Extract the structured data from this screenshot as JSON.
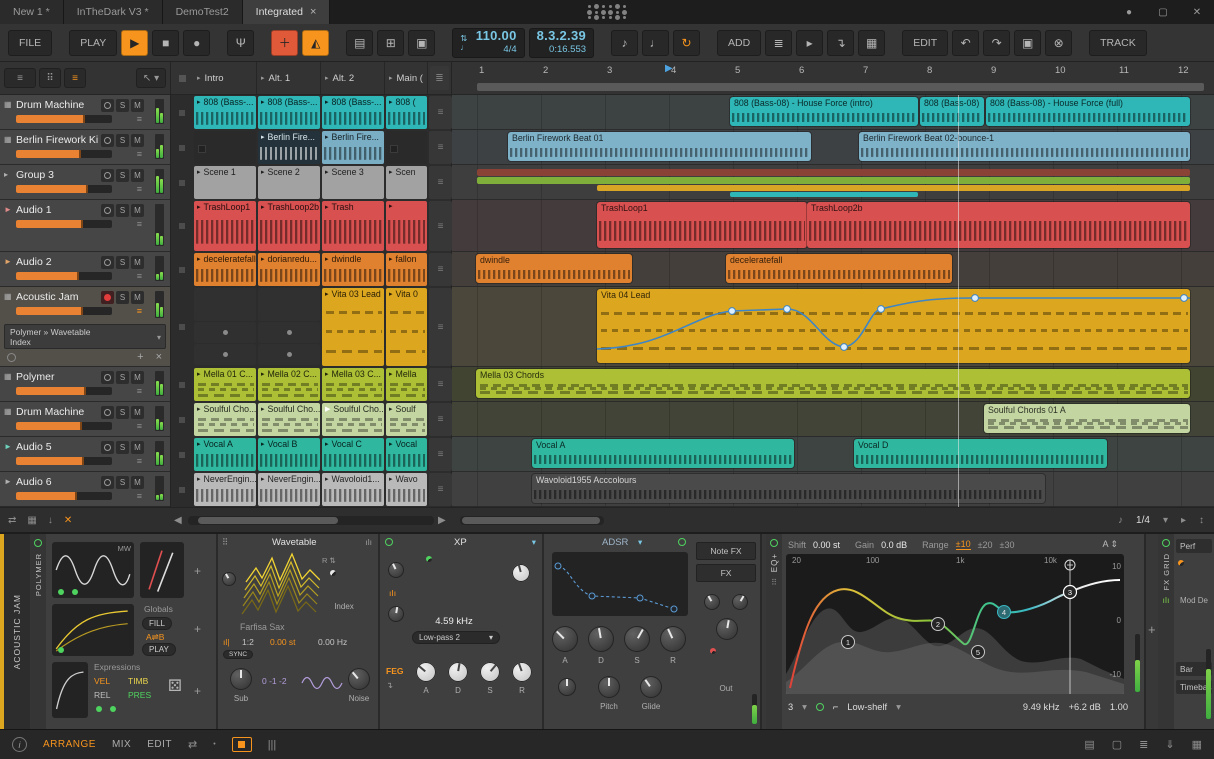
{
  "accent": "#f7941d",
  "titlebar": {
    "tabs": [
      {
        "label": "New 1 *"
      },
      {
        "label": "InTheDark V3 *"
      },
      {
        "label": "DemoTest2"
      },
      {
        "label": "Integrated",
        "close": "×"
      }
    ]
  },
  "transport": {
    "file": "FILE",
    "play_menu": "PLAY",
    "tempo": "110.00",
    "time_signature": "4/4",
    "position": "8.3.2.39",
    "time": "0:16.553",
    "add": "ADD",
    "edit": "EDIT",
    "track": "TRACK"
  },
  "scenes": {
    "headers": [
      "Intro",
      "Alt. 1",
      "Alt. 2",
      "Main ("
    ]
  },
  "ruler": [
    "1",
    "2",
    "3",
    "4",
    "5",
    "6",
    "7",
    "8",
    "9",
    "10",
    "11",
    "12"
  ],
  "track_buttons": {
    "solo": "S",
    "mute": "M"
  },
  "tracks": [
    {
      "name": "Drum Machine",
      "color": "#2fb6b6",
      "icon": "▦"
    },
    {
      "name": "Berlin Firework Kit",
      "color": "#79aec4",
      "icon": "▦"
    },
    {
      "name": "Group 3",
      "color": "#a2a2a2",
      "icon": "▸"
    },
    {
      "name": "Audio 1",
      "color": "#d85050",
      "icon": "►"
    },
    {
      "name": "Audio 2",
      "color": "#e0812f",
      "icon": "►"
    },
    {
      "name": "Acoustic Jam",
      "color": "#dca61f",
      "icon": "▦"
    },
    {
      "name": "Polymer",
      "color": "#acbf35",
      "icon": "▦"
    },
    {
      "name": "Drum Machine",
      "color": "#c3d5a1",
      "icon": "▦"
    },
    {
      "name": "Audio 5",
      "color": "#2fb7a0",
      "icon": "►"
    },
    {
      "name": "Audio 6",
      "color": "#b9b9b9",
      "icon": "►"
    }
  ],
  "device_selector": {
    "line1": "Polymer » Wavetable",
    "line2": "Index"
  },
  "launcher": {
    "rows": [
      {
        "clips": [
          "808 (Bass-...",
          "808 (Bass-...",
          "808 (Bass-...",
          "808 ("
        ]
      },
      {
        "clips": [
          "",
          "Berlin Fire...",
          "Berlin Fire...",
          ""
        ]
      },
      {
        "clips": [
          "Scene 1",
          "Scene 2",
          "Scene 3",
          "Scen"
        ]
      },
      {
        "clips": [
          "TrashLoop1",
          "TrashLoop2b",
          "Trash",
          ""
        ]
      },
      {
        "clips": [
          "deceleratefall",
          "dorianredu...",
          "dwindle",
          "fallon"
        ]
      },
      {
        "clips": [
          "",
          "",
          "Vita 03 Lead",
          "Vita 0"
        ]
      },
      {
        "clips": [
          "Mella 01 C...",
          "Mella 02 C...",
          "Mella 03 C...",
          "Mella"
        ]
      },
      {
        "clips": [
          "Soulful Cho...",
          "Soulful Cho...",
          "Soulful Cho...",
          "Soulf"
        ]
      },
      {
        "clips": [
          "Vocal A",
          "Vocal B",
          "Vocal C",
          "Vocal"
        ]
      },
      {
        "clips": [
          "NeverEngin...",
          "NeverEngin...",
          "Wavoloid1...",
          "Wavo"
        ]
      }
    ]
  },
  "arranger": {
    "snap": "1/4",
    "clips": {
      "r1a": "808 (Bass-08) - House Force (intro)",
      "r1b": "808 (Bass-08)",
      "r1c": "808 (Bass-08) - House Force (full)",
      "r2a": "Berlin Firework Beat 01",
      "r2b": "Berlin Firework Beat 02-bounce-1",
      "r4a": "TrashLoop1",
      "r4b": "TrashLoop2b",
      "r5a": "dwindle",
      "r5b": "deceleratefall",
      "r6a": "Vita 04 Lead",
      "r7a": "Mella 03 Chords",
      "r8a": "Soulful Chords 01 A",
      "r9a": "Vocal A",
      "r9b": "Vocal D",
      "r10a": "Wavoloid1955 Acccolours"
    }
  },
  "device_panel": {
    "track_label": "ACOUSTIC JAM",
    "polymer": {
      "name": "POLYMER",
      "mw": "MW",
      "globals_title": "Globals",
      "fill": "FILL",
      "ab": "A⇌B",
      "play": "PLAY",
      "expressions_title": "Expressions",
      "expressions": [
        "VEL",
        "TIMB",
        "REL",
        "PRES"
      ]
    },
    "wavetable": {
      "title": "Wavetable",
      "preset": "Farfisa Sax",
      "index": "Index",
      "ratio": "1:2",
      "detune": "0.00 st",
      "freq": "0.00 Hz",
      "sync": "SYNC",
      "sub": "Sub",
      "octaves": "0  -1  -2",
      "noise": "Noise"
    },
    "xp": {
      "title": "XP",
      "cutoff": "4.59 kHz",
      "mode": "Low-pass 2",
      "feg": "FEG",
      "env_labels": [
        "A",
        "D",
        "S",
        "R"
      ]
    },
    "adsr": {
      "title": "ADSR",
      "labels": [
        "A",
        "D",
        "S",
        "R"
      ]
    },
    "tabs": {
      "note_fx": "Note FX",
      "fx": "FX"
    },
    "out": {
      "pitch": "Pitch",
      "glide": "Glide",
      "out": "Out"
    },
    "eq": {
      "label": "EQ+",
      "shift_label": "Shift",
      "shift": "0.00 st",
      "gain_label": "Gain",
      "gain": "0.0 dB",
      "range_label": "Range",
      "ranges": [
        "±10",
        "±20",
        "±30"
      ],
      "freq_ticks": [
        "20",
        "100",
        "1k",
        "10k"
      ],
      "db_ticks": [
        "10",
        "0",
        "-10"
      ],
      "points": [
        "1",
        "2",
        "3",
        "4",
        "5"
      ],
      "band_index": "3",
      "band_type": "Low-shelf",
      "band_freq": "9.49 kHz",
      "band_gain": "+6.2 dB",
      "band_q": "1.00"
    },
    "fx_grid": {
      "label": "FX GRID",
      "perf": "Perf",
      "mod": "Mod De",
      "bar": "Bar",
      "timebase": "Timebas"
    }
  },
  "statusbar": {
    "views": [
      "ARRANGE",
      "MIX",
      "EDIT"
    ]
  }
}
